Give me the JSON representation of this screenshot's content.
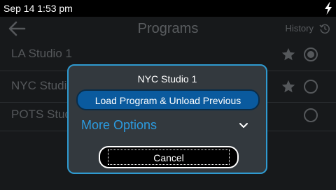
{
  "status_bar": {
    "time": "Sep 14 1:53 pm",
    "icons": [
      "bolt-icon"
    ]
  },
  "header": {
    "title": "Programs",
    "history_label": "History",
    "icons": [
      "back-arrow-icon",
      "history-icon"
    ]
  },
  "programs": [
    {
      "name": "LA Studio 1",
      "favorite": true,
      "selected": true
    },
    {
      "name": "NYC Studio 1",
      "favorite": true,
      "selected": false
    },
    {
      "name": "POTS Studio",
      "favorite": false,
      "selected": false
    }
  ],
  "dialog": {
    "title": "NYC Studio 1",
    "primary_label": "Load Program & Unload Previous",
    "more_options_label": "More Options",
    "cancel_label": "Cancel",
    "icons": [
      "chevron-down-icon"
    ]
  },
  "colors": {
    "accent": "#2f9ad0",
    "primary_button": "#0a5a9e",
    "link": "#2b9be0",
    "background": "#17191b"
  }
}
